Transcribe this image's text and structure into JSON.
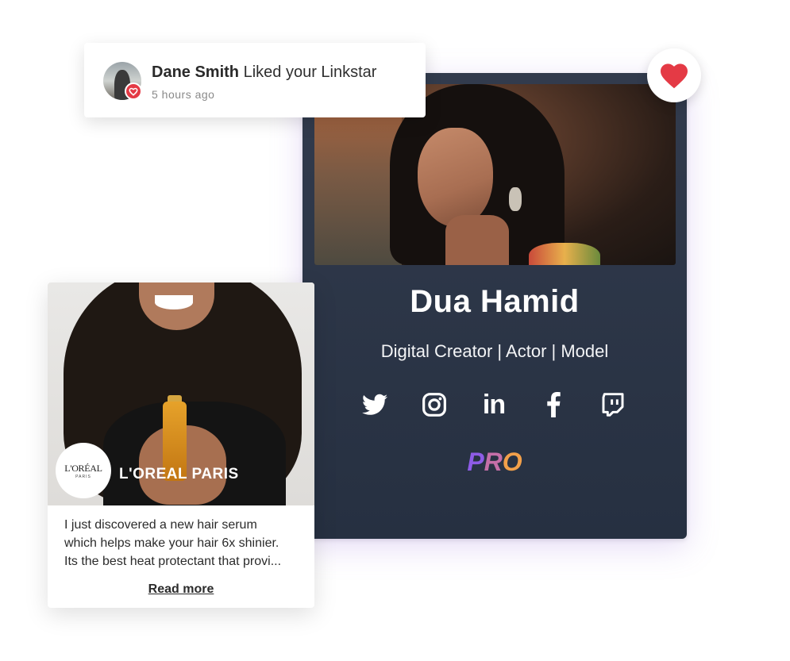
{
  "notification": {
    "user_name": "Dane Smith",
    "action": "Liked your Linkstar",
    "time": "5 hours ago"
  },
  "profile": {
    "name": "Dua Hamid",
    "subtitle": "Digital Creator | Actor | Model",
    "socials": [
      {
        "icon": "twitter-icon"
      },
      {
        "icon": "instagram-icon"
      },
      {
        "icon": "linkedin-icon",
        "text": "in"
      },
      {
        "icon": "facebook-icon"
      },
      {
        "icon": "twitch-icon"
      }
    ],
    "badge": {
      "p1": "P",
      "p2": "R",
      "p3": "O"
    },
    "badge_colors": [
      "#8e5ce6",
      "#c56fa8",
      "#f2a04a"
    ],
    "card_color": "#2b3445"
  },
  "post": {
    "brand_logo_line1": "L'ORÉAL",
    "brand_logo_line2": "PARIS",
    "brand_name": "L'OREAL PARIS",
    "body_lines": [
      "I just discovered a new hair serum",
      "which helps make your hair 6x shinier.",
      "Its the best heat protectant that provi..."
    ],
    "read_more": "Read more"
  },
  "colors": {
    "heart": "#e43a45"
  }
}
